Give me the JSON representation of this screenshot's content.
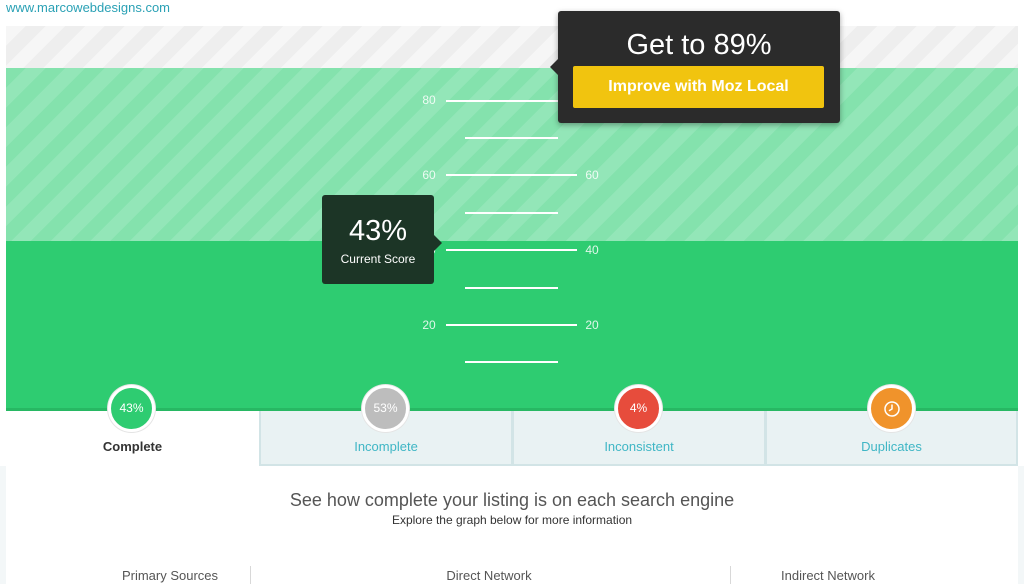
{
  "site": {
    "url": "www.marcowebdesigns.com"
  },
  "chart": {
    "ticks_left": [
      "80",
      "60",
      "40",
      "20"
    ],
    "ticks_right": [
      "60",
      "40",
      "20"
    ]
  },
  "goal": {
    "title": "Get to 89%",
    "button_label": "Improve with Moz Local",
    "button_color": "#f1c40f"
  },
  "score": {
    "value": "43%",
    "label": "Current Score",
    "fill_percent": 43
  },
  "tabs": [
    {
      "label": "Complete",
      "badge": "43%",
      "color": "#2ecc71",
      "active": true
    },
    {
      "label": "Incomplete",
      "badge": "53%",
      "color": "#bdbdbd",
      "active": false
    },
    {
      "label": "Inconsistent",
      "badge": "4%",
      "color": "#e74c3c",
      "active": false
    },
    {
      "label": "Duplicates",
      "badge": "clock-icon",
      "color": "#f0932b",
      "active": false
    }
  ],
  "info": {
    "headline": "See how complete your listing is on each search engine",
    "subline": "Explore the graph below for more information"
  },
  "networks": [
    "Primary Sources",
    "Direct Network",
    "Indirect Network"
  ]
}
